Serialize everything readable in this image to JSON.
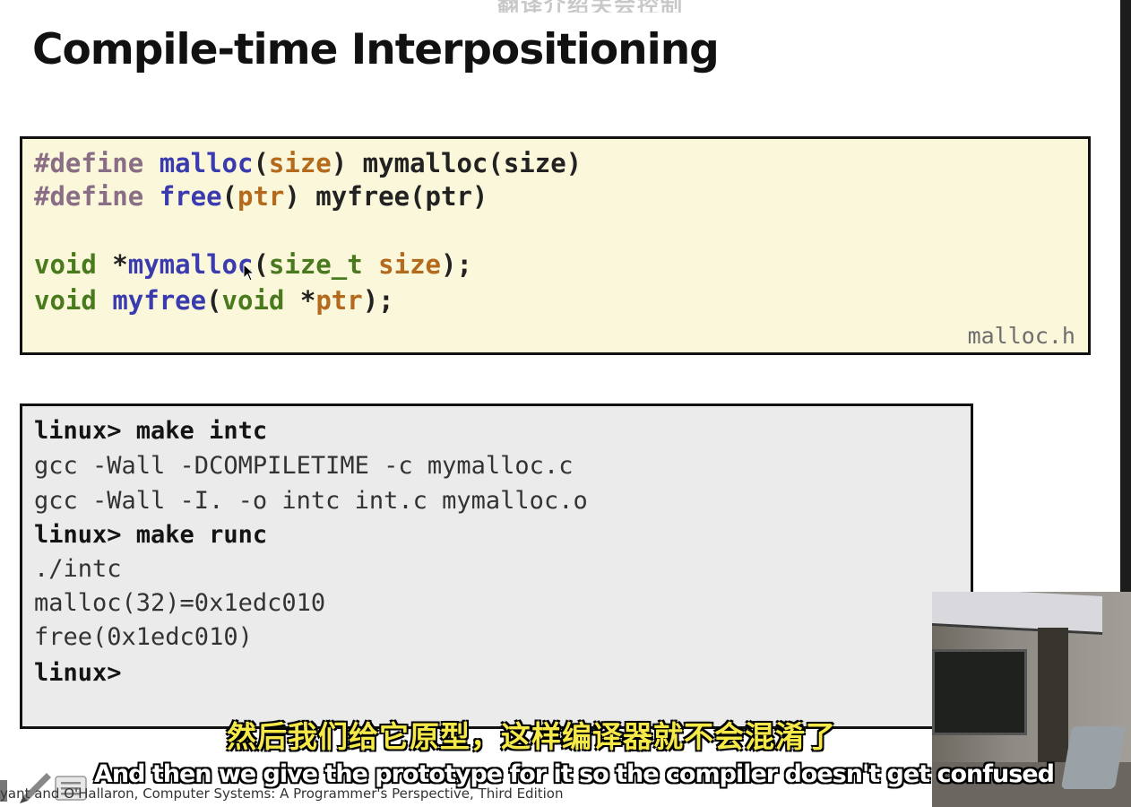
{
  "top_subtitle": "翻译介绍关会控制",
  "slide": {
    "title": "Compile-time Interpositioning",
    "code_file": "malloc.h",
    "code": {
      "l1": {
        "a": "#define",
        "b": "malloc",
        "c": "(",
        "d": "size",
        "e": ") mymalloc(size)"
      },
      "l2": {
        "a": "#define",
        "b": "free",
        "c": "(",
        "d": "ptr",
        "e": ") myfree(ptr)"
      },
      "l3": {
        "a": "void",
        "b": " *",
        "c": "mymalloc",
        "d": "(",
        "e": "size_t",
        "f": " ",
        "g": "size",
        "h": ");"
      },
      "l4": {
        "a": "void",
        "b": " ",
        "c": "myfree",
        "d": "(",
        "e": "void",
        "f": " *",
        "g": "ptr",
        "h": ");"
      }
    },
    "terminal": [
      {
        "text": "linux> make intc",
        "cmd": true
      },
      {
        "text": "gcc -Wall -DCOMPILETIME -c mymalloc.c",
        "cmd": false
      },
      {
        "text": "gcc -Wall -I. -o intc int.c mymalloc.o",
        "cmd": false
      },
      {
        "text": "linux> make runc",
        "cmd": true
      },
      {
        "text": "./intc",
        "cmd": false
      },
      {
        "text": "malloc(32)=0x1edc010",
        "cmd": false
      },
      {
        "text": "free(0x1edc010)",
        "cmd": false
      },
      {
        "text": "linux>",
        "cmd": true
      }
    ],
    "footer": "yant and O'Hallaron, Computer Systems: A Programmer's Perspective, Third Edition"
  },
  "subtitles": {
    "chinese": "然后我们给它原型，这样编译器就不会混淆了",
    "english": "And then we give the prototype for it so the compiler doesn't get confused"
  },
  "colors": {
    "code_bg": "#fbf7da",
    "terminal_bg": "#ebebeb",
    "subtitle_cn": "#f5e94a"
  },
  "icons": [
    "pen-tool-icon",
    "menu-icon",
    "mouse-cursor-icon"
  ]
}
